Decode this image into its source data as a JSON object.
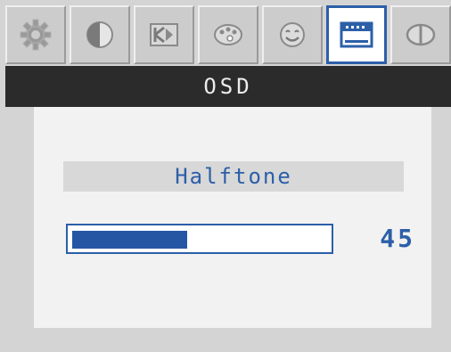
{
  "osd": {
    "title": "OSD",
    "tabs": [
      {
        "icon": "gear-icon",
        "active": false
      },
      {
        "icon": "contrast-icon",
        "active": false
      },
      {
        "icon": "image-position-icon",
        "active": false
      },
      {
        "icon": "color-palette-icon",
        "active": false
      },
      {
        "icon": "face-icon",
        "active": false
      },
      {
        "icon": "osd-menu-icon",
        "active": true
      },
      {
        "icon": "reset-icon",
        "active": false
      }
    ],
    "setting": {
      "label": "Halftone",
      "value": "45",
      "level": 0.45
    }
  },
  "colors": {
    "accent": "#2c5fa8",
    "title_bar": "#2b2b2b",
    "panel": "#f2f2f2",
    "frame": "#d4d4d4"
  }
}
